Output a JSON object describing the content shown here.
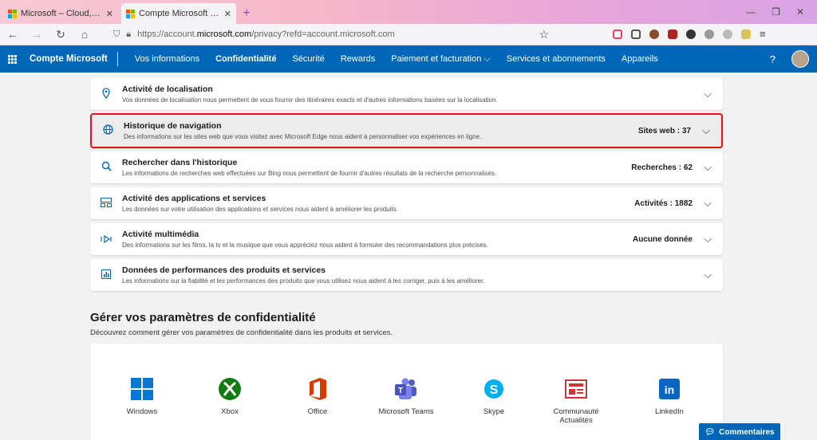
{
  "browser": {
    "tabs": [
      {
        "label": "Microsoft – Cloud, ordinateurs",
        "active": false
      },
      {
        "label": "Compte Microsoft | Confidentia",
        "active": true
      }
    ],
    "url_prefix": "https://account.",
    "url_host": "microsoft.com",
    "url_suffix": "/privacy?refd=account.microsoft.com"
  },
  "header": {
    "brand": "Compte Microsoft",
    "nav": [
      {
        "label": "Vos informations",
        "active": false
      },
      {
        "label": "Confidentialité",
        "active": true
      },
      {
        "label": "Sécurité",
        "active": false
      },
      {
        "label": "Rewards",
        "active": false
      },
      {
        "label": "Paiement et facturation",
        "active": false,
        "dropdown": true
      },
      {
        "label": "Services et abonnements",
        "active": false
      },
      {
        "label": "Appareils",
        "active": false
      }
    ],
    "help": "?"
  },
  "activities": [
    {
      "icon": "location-pin-icon",
      "title": "Activité de localisation",
      "desc": "Vos données de localisation nous permettent de vous fournir des itinéraires exacts et d'autres informations basées sur la localisation.",
      "stat": ""
    },
    {
      "icon": "globe-icon",
      "title": "Historique de navigation",
      "desc": "Des informations sur les sites web que vous visitez avec Microsoft Edge nous aident à personnaliser vos expériences en ligne.",
      "stat": "Sites web : 37",
      "highlighted": true
    },
    {
      "icon": "search-icon",
      "title": "Rechercher dans l'historique",
      "desc": "Les informations de recherches web effectuées sur Bing nous permettent de fournir d'autres résultats de la recherche personnalisés.",
      "stat": "Recherches : 62"
    },
    {
      "icon": "apps-services-icon",
      "title": "Activité des applications et services",
      "desc": "Les données sur votre utilisation des applications et services nous aident à améliorer les produits.",
      "stat": "Activités : 1882"
    },
    {
      "icon": "media-icon",
      "title": "Activité multimédia",
      "desc": "Des informations sur les films, la tv et la musique que vous appréciez nous aident à formuler des recommandations plus précises.",
      "stat": "Aucune donnée"
    },
    {
      "icon": "performance-chart-icon",
      "title": "Données de performances des produits et services",
      "desc": "Les informations sur la fiabilité et les performances des produits que vous utilisez nous aident à les corriger, puis à les améliorer.",
      "stat": ""
    }
  ],
  "manage": {
    "title": "Gérer vos paramètres de confidentialité",
    "subtitle": "Découvrez comment gérer vos paramètres de confidentialité dans les produits et services."
  },
  "products": [
    {
      "label": "Windows",
      "icon": "windows-icon"
    },
    {
      "label": "Xbox",
      "icon": "xbox-icon"
    },
    {
      "label": "Office",
      "icon": "office-icon"
    },
    {
      "label": "Microsoft Teams",
      "icon": "teams-icon"
    },
    {
      "label": "Skype",
      "icon": "skype-icon"
    },
    {
      "label": "Communauté\nActualités",
      "icon": "news-icon"
    },
    {
      "label": "LinkedIn",
      "icon": "linkedin-icon"
    }
  ],
  "feedback_label": "Commentaires",
  "colors": {
    "accent": "#0067b8",
    "highlight": "#e0121a"
  }
}
